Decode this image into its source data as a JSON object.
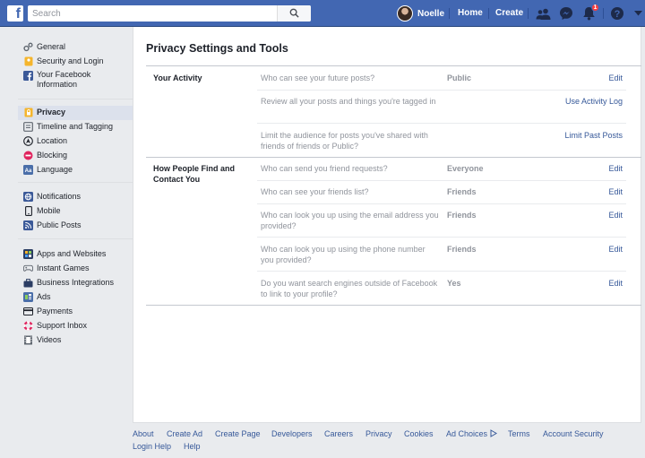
{
  "header": {
    "logo_letter": "f",
    "search_placeholder": "Search",
    "profile_name": "Noelle",
    "nav": {
      "home": "Home",
      "create": "Create"
    },
    "notification_count": "1",
    "brand_color": "#4267b2"
  },
  "sidebar": {
    "groups": [
      [
        {
          "label": "General",
          "icon": "gear-pair-icon"
        },
        {
          "label": "Security and Login",
          "icon": "badge-icon"
        },
        {
          "label": "Your Facebook Information",
          "icon": "facebook-icon"
        }
      ],
      [
        {
          "label": "Privacy",
          "icon": "lock-icon",
          "active": true
        },
        {
          "label": "Timeline and Tagging",
          "icon": "timeline-icon"
        },
        {
          "label": "Location",
          "icon": "location-icon"
        },
        {
          "label": "Blocking",
          "icon": "blocking-icon"
        },
        {
          "label": "Language",
          "icon": "language-icon"
        }
      ],
      [
        {
          "label": "Notifications",
          "icon": "globe-icon"
        },
        {
          "label": "Mobile",
          "icon": "mobile-icon"
        },
        {
          "label": "Public Posts",
          "icon": "rss-icon"
        }
      ],
      [
        {
          "label": "Apps and Websites",
          "icon": "apps-icon"
        },
        {
          "label": "Instant Games",
          "icon": "gamepad-icon"
        },
        {
          "label": "Business Integrations",
          "icon": "business-icon"
        },
        {
          "label": "Ads",
          "icon": "ads-icon"
        },
        {
          "label": "Payments",
          "icon": "card-icon"
        },
        {
          "label": "Support Inbox",
          "icon": "lifebuoy-icon"
        },
        {
          "label": "Videos",
          "icon": "film-icon"
        }
      ]
    ]
  },
  "main": {
    "title": "Privacy Settings and Tools",
    "sections": [
      {
        "title": "Your Activity",
        "rows": [
          {
            "question": "Who can see your future posts?",
            "value": "Public",
            "action": "Edit"
          },
          {
            "question": "Review all your posts and things you're tagged in",
            "value": "",
            "action": "Use Activity Log"
          },
          {
            "question": "Limit the audience for posts you've shared with friends of friends or Public?",
            "value": "",
            "action": "Limit Past Posts"
          }
        ]
      },
      {
        "title": "How People Find and Contact You",
        "rows": [
          {
            "question": "Who can send you friend requests?",
            "value": "Everyone",
            "action": "Edit"
          },
          {
            "question": "Who can see your friends list?",
            "value": "Friends",
            "action": "Edit"
          },
          {
            "question": "Who can look you up using the email address you provided?",
            "value": "Friends",
            "action": "Edit"
          },
          {
            "question": "Who can look you up using the phone number you provided?",
            "value": "Friends",
            "action": "Edit"
          },
          {
            "question": "Do you want search engines outside of Facebook to link to your profile?",
            "value": "Yes",
            "action": "Edit"
          }
        ]
      }
    ]
  },
  "footer": {
    "links": [
      "About",
      "Create Ad",
      "Create Page",
      "Developers",
      "Careers",
      "Privacy",
      "Cookies",
      "Ad Choices",
      "Terms",
      "Account Security",
      "Login Help",
      "Help"
    ]
  }
}
